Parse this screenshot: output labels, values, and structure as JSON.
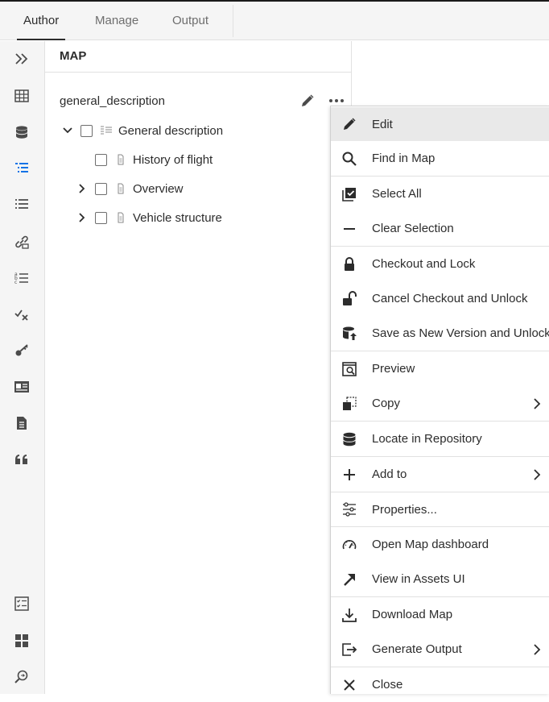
{
  "tabs": [
    {
      "label": "Author",
      "active": true
    },
    {
      "label": "Manage",
      "active": false
    },
    {
      "label": "Output",
      "active": false
    }
  ],
  "rail_icons": [
    "expand-icon",
    "grid-icon",
    "repository-icon",
    "map-view-icon",
    "list-icon",
    "link-icon",
    "ordered-list-icon",
    "spell-check-icon",
    "key-icon",
    "id-card-icon",
    "document-icon",
    "quote-icon",
    "checklist-icon",
    "dashboard-icon",
    "find-replace-icon"
  ],
  "map_panel": {
    "header": "MAP",
    "root_title": "general_description",
    "tree": [
      {
        "label": "General description",
        "expanded": true,
        "level": 0,
        "has_children": true
      },
      {
        "label": "History of flight",
        "level": 1,
        "has_children": false
      },
      {
        "label": "Overview",
        "level": 1,
        "has_children": true,
        "expanded": false
      },
      {
        "label": "Vehicle structure",
        "level": 1,
        "has_children": true,
        "expanded": false
      }
    ]
  },
  "context_menu": {
    "items": [
      {
        "label": "Edit",
        "icon": "pencil-icon",
        "highlighted": true
      },
      {
        "label": "Find in Map",
        "icon": "search-icon"
      },
      {
        "label": "Select All",
        "icon": "select-all-icon"
      },
      {
        "label": "Clear Selection",
        "icon": "minus-icon"
      },
      {
        "label": "Checkout and Lock",
        "icon": "lock-icon"
      },
      {
        "label": "Cancel Checkout and Unlock",
        "icon": "unlock-icon"
      },
      {
        "label": "Save as New Version and Unlock",
        "icon": "save-version-icon"
      },
      {
        "label": "Preview",
        "icon": "preview-icon"
      },
      {
        "label": "Copy",
        "icon": "copy-icon",
        "submenu": true
      },
      {
        "label": "Locate in Repository",
        "icon": "database-icon"
      },
      {
        "label": "Add to",
        "icon": "plus-icon",
        "submenu": true
      },
      {
        "label": "Properties...",
        "icon": "properties-icon"
      },
      {
        "label": "Open Map dashboard",
        "icon": "gauge-icon"
      },
      {
        "label": "View in Assets UI",
        "icon": "arrow-up-right-icon"
      },
      {
        "label": "Download Map",
        "icon": "download-icon"
      },
      {
        "label": "Generate Output",
        "icon": "export-icon",
        "submenu": true
      },
      {
        "label": "Close",
        "icon": "close-icon"
      }
    ]
  }
}
